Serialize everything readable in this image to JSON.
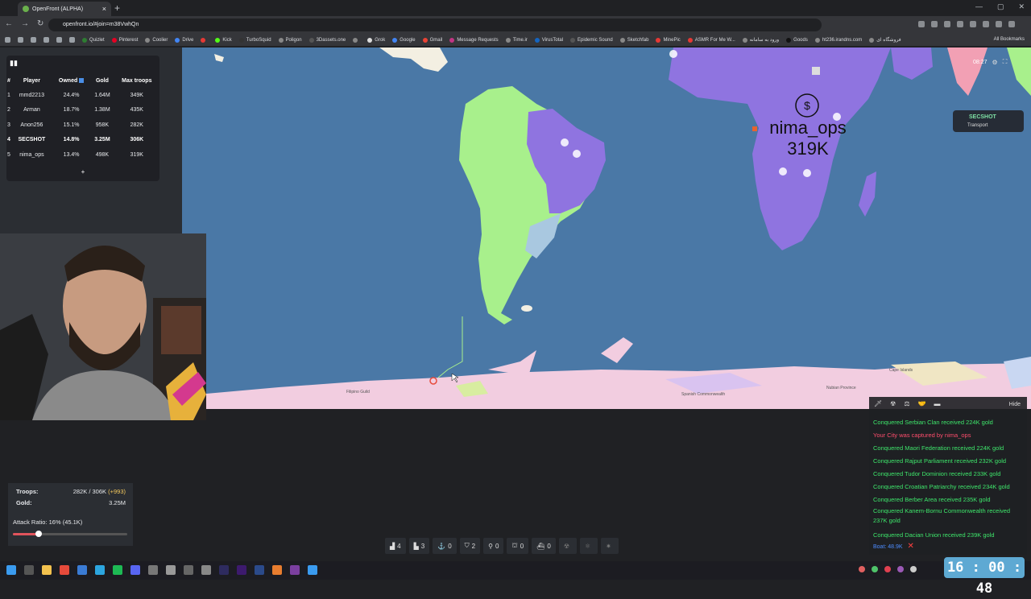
{
  "browser": {
    "tab_title": "OpenFront (ALPHA)",
    "url": "openfront.io/#join=m38VwhQn",
    "bookmarks": [
      "Quizlet",
      "Pinterest",
      "Coolier",
      "Drive",
      "",
      "Kick",
      "TurboSquid",
      "Poligon",
      "3Dassets.one",
      "",
      "Grok",
      "Google",
      "Gmail",
      "Message Requests",
      "Time.ir",
      "VirusTotal",
      "Epidemic Sound",
      "Sketchfab",
      "MinePic",
      "ASMR For Me W...",
      "ورود به سامانه",
      "Goods",
      "ht236.irandns.com",
      "فروشگاه ای"
    ],
    "bookmark_colors": [
      "#2e7d32",
      "#e60023",
      "#888",
      "#4285f4",
      "#e53935",
      "#53fc18",
      "#333",
      "#888",
      "#555",
      "#888",
      "#ddd",
      "#4285f4",
      "#ea4335",
      "#c13584",
      "#888",
      "#1565c0",
      "#555",
      "#888",
      "#e53935",
      "#e53935",
      "#888",
      "#111",
      "#888",
      "#888"
    ],
    "all_bookmarks": "All Bookmarks"
  },
  "leaderboard": {
    "headers": [
      "#",
      "Player",
      "Owned",
      "Gold",
      "Max troops"
    ],
    "rows": [
      {
        "rank": "1",
        "player": "mmd2213",
        "owned": "24.4%",
        "gold": "1.64M",
        "troops": "349K"
      },
      {
        "rank": "2",
        "player": "Arman",
        "owned": "18.7%",
        "gold": "1.38M",
        "troops": "435K"
      },
      {
        "rank": "3",
        "player": "Anon256",
        "owned": "15.1%",
        "gold": "958K",
        "troops": "282K"
      },
      {
        "rank": "4",
        "player": "SECSHOT",
        "owned": "14.8%",
        "gold": "3.25M",
        "troops": "306K"
      },
      {
        "rank": "5",
        "player": "nima_ops",
        "owned": "13.4%",
        "gold": "498K",
        "troops": "319K"
      }
    ],
    "more": "+"
  },
  "timer": "08:27",
  "hover": {
    "name": "SECSHOT",
    "unit": "Transport"
  },
  "map_labels": {
    "enemy_name": "nima_ops",
    "enemy_troops": "319K",
    "small": [
      "Filipino Guild",
      "Spanish Commonwealth",
      "Nubian Province",
      "Cape Islands"
    ],
    "small_vals": [
      "11.7K",
      "5.6K",
      "7.8K",
      ""
    ]
  },
  "events": {
    "hide": "Hide",
    "items": [
      {
        "text": "Conquered Serbian Clan received 224K gold",
        "type": "good"
      },
      {
        "text": "Your City was captured by nima_ops",
        "type": "bad"
      },
      {
        "text": "Conquered Maori Federation received 224K gold",
        "type": "good"
      },
      {
        "text": "Conquered Rajput Parliament received 232K gold",
        "type": "good"
      },
      {
        "text": "Conquered Tudor Dominion received 233K gold",
        "type": "good"
      },
      {
        "text": "Conquered Croatian Patriarchy received 234K gold",
        "type": "good"
      },
      {
        "text": "Conquered Berber Area received 235K gold",
        "type": "good"
      },
      {
        "text": "Conquered Kanem-Bornu Commonwealth received 237K gold",
        "type": "good two"
      },
      {
        "text": "Conquered Dacian Union received 239K gold",
        "type": "good"
      }
    ],
    "boat": "Boat: 48.9K",
    "boat_close": "✕"
  },
  "stats": {
    "troops_label": "Troops:",
    "troops_value": "282K / 306K",
    "troops_bonus": "(+993)",
    "gold_label": "Gold:",
    "gold_value": "3.25M",
    "attack_ratio": "Attack Ratio: 16% (45.1K)",
    "attack_ratio_fraction": 0.16
  },
  "buildbar": [
    {
      "icon": "city-icon",
      "glyph": "▟",
      "count": "4"
    },
    {
      "icon": "factory-icon",
      "glyph": "▙",
      "count": "3"
    },
    {
      "icon": "port-icon",
      "glyph": "⚓",
      "count": "0"
    },
    {
      "icon": "defense-icon",
      "glyph": "⛉",
      "count": "2"
    },
    {
      "icon": "missile-silo-icon",
      "glyph": "⚲",
      "count": "0"
    },
    {
      "icon": "sam-icon",
      "glyph": "⛫",
      "count": "0"
    },
    {
      "icon": "warship-icon",
      "glyph": "⛴",
      "count": "0"
    },
    {
      "icon": "atom-bomb-icon",
      "glyph": "☢",
      "count": ""
    },
    {
      "icon": "hydrogen-bomb-icon",
      "glyph": "⚛",
      "count": ""
    },
    {
      "icon": "mirv-icon",
      "glyph": "✷",
      "count": ""
    }
  ],
  "clock": "16 : 00 : 48",
  "colors": {
    "ocean": "#4a78a6",
    "self": "#a8f08c",
    "enemy": "#8f74e0",
    "good_event": "#3ee66b",
    "bad_event": "#ff4d6d"
  }
}
